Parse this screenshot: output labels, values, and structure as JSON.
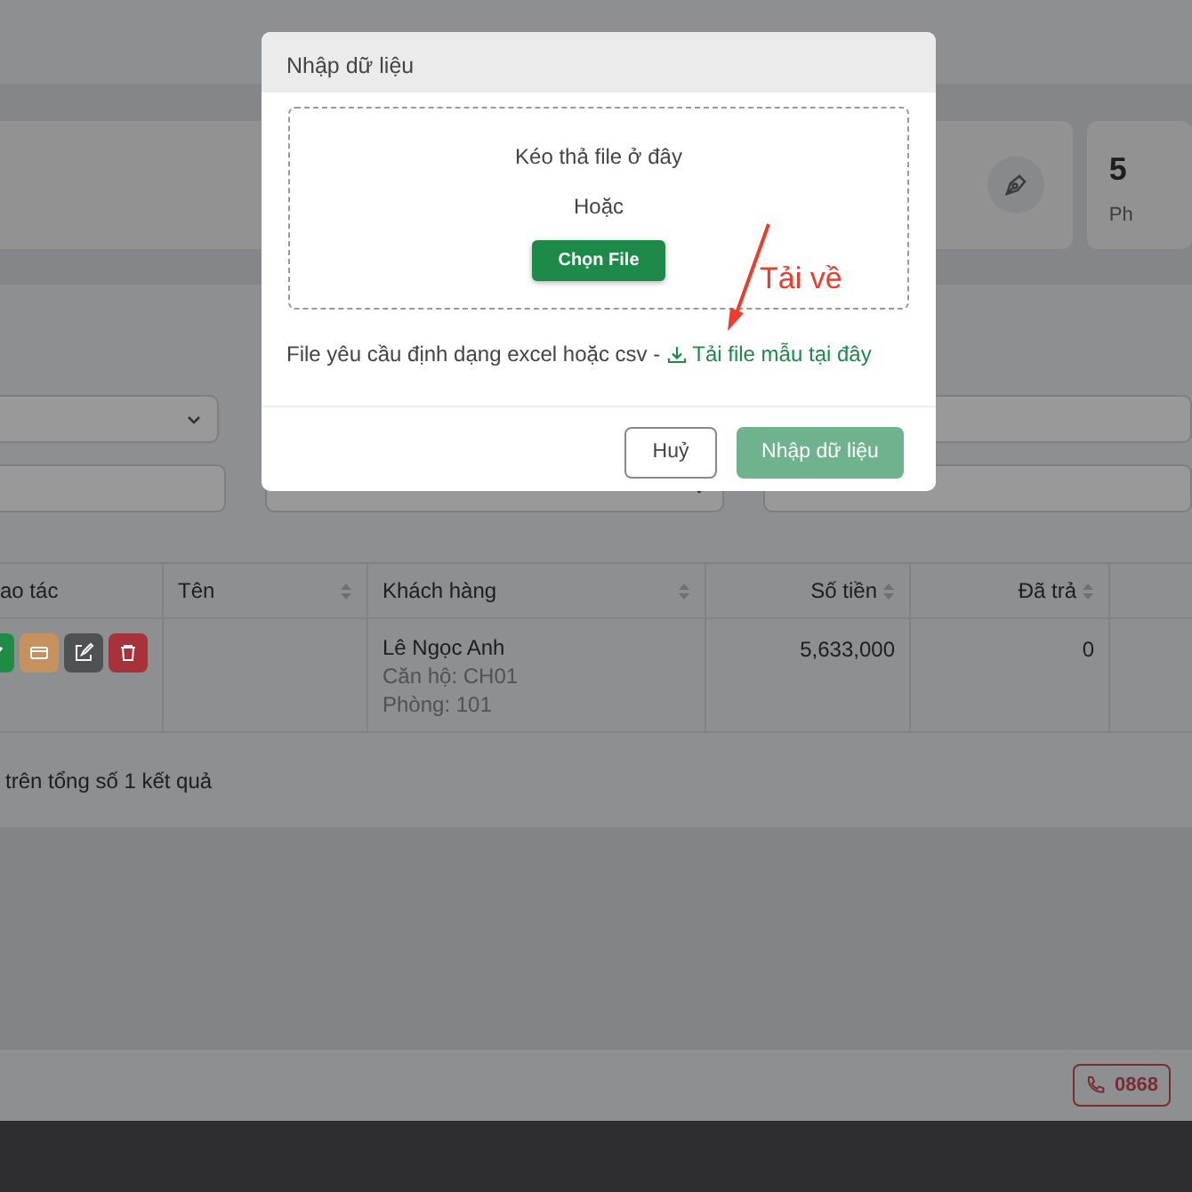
{
  "stat_cards": [
    {
      "kind": "icon"
    },
    {
      "kind": "number",
      "value": "5",
      "label": "Ph"
    }
  ],
  "filters": [
    {
      "kind": "select"
    },
    {
      "kind": "input"
    },
    {
      "kind": "select"
    },
    {
      "kind": "input"
    },
    {
      "kind": "input"
    }
  ],
  "table": {
    "columns": [
      {
        "label": "ao tác",
        "sortable": false
      },
      {
        "label": "Tên",
        "sortable": true
      },
      {
        "label": "Khách hàng",
        "sortable": true
      },
      {
        "label": "Số tiền",
        "sortable": true
      },
      {
        "label": "Đã trả",
        "sortable": true
      }
    ],
    "rows": [
      {
        "actions": [
          {
            "kind": "check",
            "color": "#1f8c45"
          },
          {
            "kind": "card",
            "color": "#c4915f"
          },
          {
            "kind": "edit",
            "color": "#4f5253"
          },
          {
            "kind": "delete",
            "color": "#a8323a"
          }
        ],
        "name": "",
        "customer": [
          "Lê Ngọc Anh",
          "Căn hộ: CH01",
          "Phòng: 101"
        ],
        "amount": "5,633,000",
        "paid": "0"
      }
    ]
  },
  "pagination_text": "trên tổng số 1 kết quả",
  "footer": {
    "phone": "0868"
  },
  "modal": {
    "title": "Nhập dữ liệu",
    "drop_text": "Kéo thả file ở đây",
    "or_text": "Hoặc",
    "choose_button": "Chọn File",
    "hint": "File yêu cầu định dạng excel hoặc csv -",
    "download_link": "Tải file mẫu tại đây",
    "annotation": "Tải về",
    "buttons": [
      {
        "kind": "cancel",
        "label": "Huỷ",
        "disabled": false
      },
      {
        "kind": "submit",
        "label": "Nhập dữ liệu",
        "disabled": true
      }
    ]
  }
}
